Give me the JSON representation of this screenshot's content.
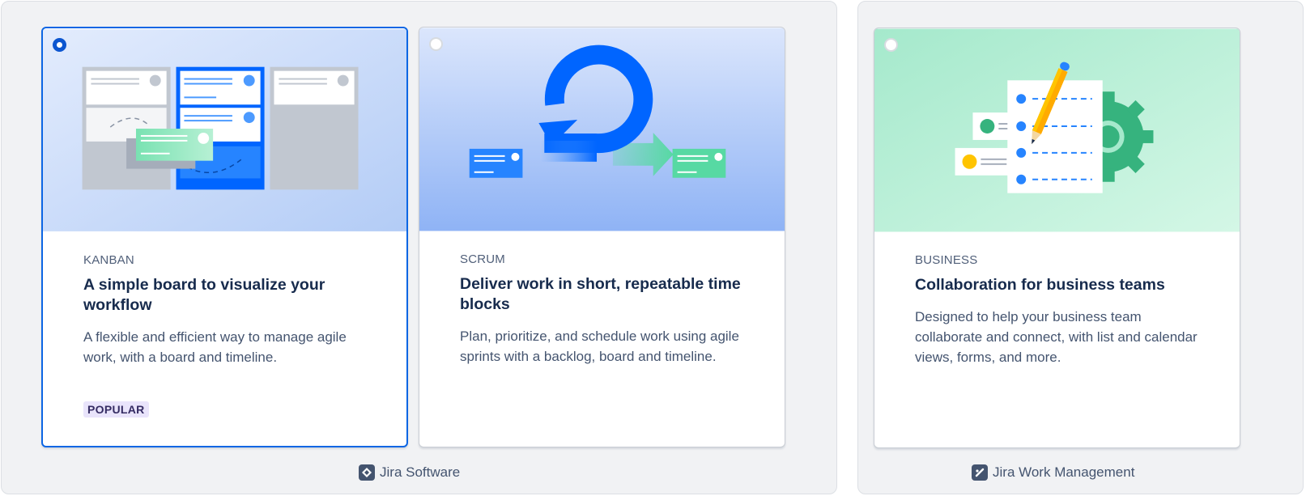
{
  "groups": [
    {
      "product": "Jira Software",
      "icon": "jira-software-icon",
      "cards": [
        {
          "eyebrow": "KANBAN",
          "title": "A simple board to visualize your workflow",
          "description": "A flexible and efficient way to manage agile work, with a board and timeline.",
          "badge": "POPULAR",
          "selected": true,
          "illustration": "kanban-board-illustration"
        },
        {
          "eyebrow": "SCRUM",
          "title": "Deliver work in short, repeatable time blocks",
          "description": "Plan, prioritize, and schedule work using agile sprints with a backlog, board and timeline.",
          "selected": false,
          "illustration": "sprint-cycle-illustration"
        }
      ]
    },
    {
      "product": "Jira Work Management",
      "icon": "jira-work-management-icon",
      "cards": [
        {
          "eyebrow": "BUSINESS",
          "title": "Collaboration for business teams",
          "description": "Designed to help your business team collaborate and connect, with list and calendar views, forms, and more.",
          "selected": false,
          "illustration": "checklist-pencil-illustration"
        }
      ]
    }
  ],
  "colors": {
    "selected_border": "#0c66e4",
    "badge_bg": "#e9e4fb",
    "blue_accent": "#0065ff",
    "green_accent": "#57d9a3"
  }
}
